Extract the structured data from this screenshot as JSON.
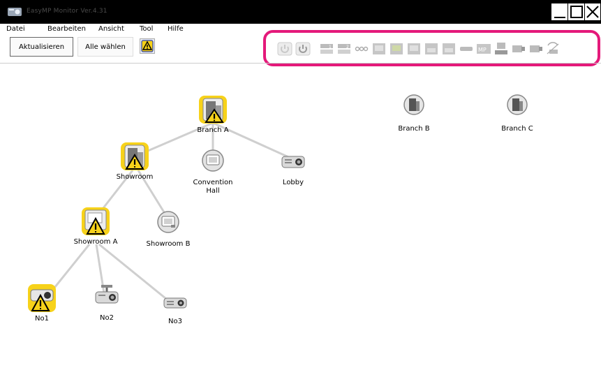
{
  "window": {
    "title": "EasyMP Monitor Ver.4.31"
  },
  "menu": [
    {
      "label": "Datei"
    },
    {
      "label": "Bearbeiten"
    },
    {
      "label": "Ansicht"
    },
    {
      "label": "Tool"
    },
    {
      "label": "Hilfe"
    }
  ],
  "toolbar": {
    "refresh_label": "Aktualisieren",
    "select_all_label": "Alle wählen",
    "icons": [
      "power-off-icon",
      "power-on-icon",
      "input-computer1-icon",
      "input-computer2-icon",
      "input-video-icon",
      "input-s-video-icon",
      "input-component-icon",
      "input-rgb-icon",
      "input-hdmi-icon",
      "input-dvi-icon",
      "input-usb-icon",
      "mp-icon",
      "network-icon",
      "input-lan1-icon",
      "input-lan2-icon",
      "wireless-icon"
    ]
  },
  "nodes": [
    {
      "id": "branch-a",
      "label": "Branch A",
      "type": "building",
      "warning": true
    },
    {
      "id": "branch-b",
      "label": "Branch B",
      "type": "building",
      "warning": false
    },
    {
      "id": "branch-c",
      "label": "Branch C",
      "type": "building",
      "warning": false
    },
    {
      "id": "showroom",
      "label": "Showroom",
      "type": "building",
      "warning": true
    },
    {
      "id": "convention-hall",
      "label": "Convention Hall",
      "type": "room",
      "warning": false
    },
    {
      "id": "lobby",
      "label": "Lobby",
      "type": "projector",
      "warning": false
    },
    {
      "id": "showroom-a",
      "label": "Showroom A",
      "type": "room",
      "warning": true
    },
    {
      "id": "showroom-b",
      "label": "Showroom B",
      "type": "room",
      "warning": false
    },
    {
      "id": "no1",
      "label": "No1",
      "type": "projector",
      "warning": true
    },
    {
      "id": "no2",
      "label": "No2",
      "type": "projector",
      "warning": false
    },
    {
      "id": "no3",
      "label": "No3",
      "type": "projector",
      "warning": false
    }
  ],
  "colors": {
    "highlight": "#e4197a",
    "warning": "#f7d21a",
    "line": "#cfcfcf"
  }
}
